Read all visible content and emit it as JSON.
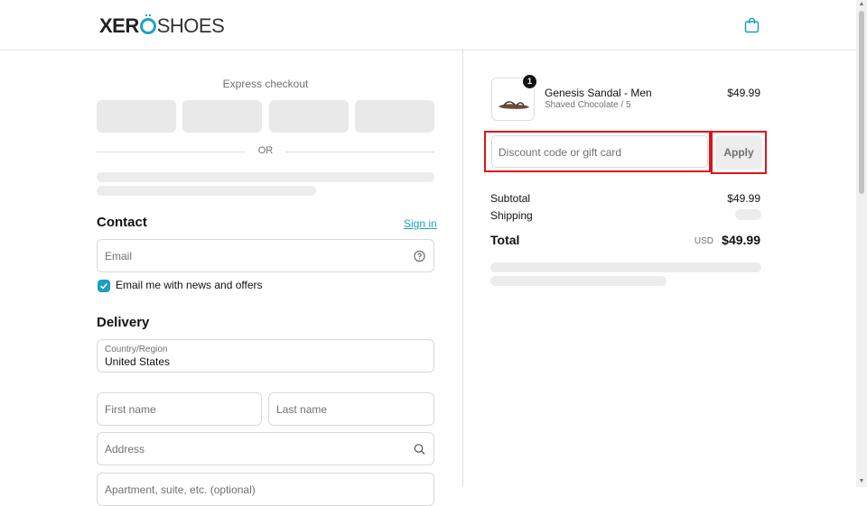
{
  "brand": {
    "logo_left": "XER",
    "logo_right": "SHOES",
    "accent": "#1a9fc1"
  },
  "express": {
    "title": "Express checkout",
    "or_label": "OR"
  },
  "contact": {
    "title": "Contact",
    "sign_in": "Sign in",
    "email_placeholder": "Email",
    "newsletter_label": "Email me with news and offers",
    "newsletter_checked": true
  },
  "delivery": {
    "title": "Delivery",
    "country_label": "Country/Region",
    "country_value": "United States",
    "first_name_placeholder": "First name",
    "last_name_placeholder": "Last name",
    "address_placeholder": "Address",
    "apartment_placeholder": "Apartment, suite, etc. (optional)"
  },
  "order": {
    "item": {
      "name": "Genesis Sandal - Men",
      "variant": "Shaved Chocolate / 5",
      "price": "$49.99",
      "quantity": "1"
    },
    "discount_placeholder": "Discount code or gift card",
    "apply_label": "Apply",
    "subtotal_label": "Subtotal",
    "subtotal_value": "$49.99",
    "shipping_label": "Shipping",
    "total_label": "Total",
    "total_currency": "USD",
    "total_value": "$49.99"
  },
  "highlight_color": "#e0121b"
}
